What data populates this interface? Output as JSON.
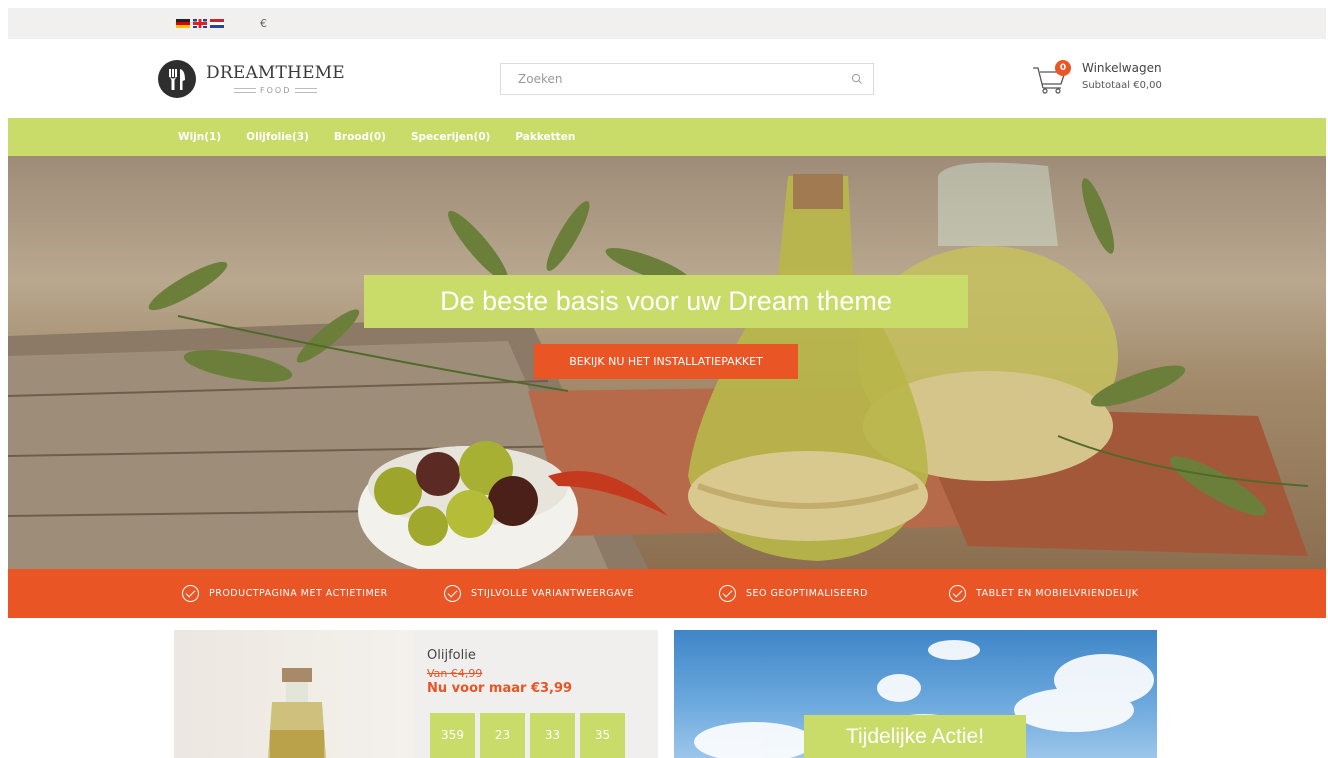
{
  "topbar": {
    "flags": [
      "flag-de",
      "flag-en",
      "flag-nl"
    ],
    "currency": "€"
  },
  "header": {
    "logo_name": "DREAMTHEME",
    "logo_sub": "FOOD",
    "search": {
      "placeholder": "Zoeken",
      "icon": "search-icon"
    },
    "cart": {
      "icon": "cart-icon",
      "count": "0",
      "title": "Winkelwagen",
      "subtotal": "Subtotaal €0,00"
    }
  },
  "nav": {
    "items": [
      {
        "label": "Wijn(1)"
      },
      {
        "label": "Olijfolie(3)"
      },
      {
        "label": "Brood(0)"
      },
      {
        "label": "Specerijen(0)"
      },
      {
        "label": "Pakketten"
      }
    ]
  },
  "hero": {
    "title": "De beste basis voor uw Dream theme",
    "button": "BEKIJK NU HET INSTALLATIEPAKKET"
  },
  "features": [
    {
      "label": "PRODUCTPAGINA MET ACTIETIMER",
      "icon": "check-circle-icon"
    },
    {
      "label": "STIJLVOLLE VARIANTWEERGAVE",
      "icon": "check-circle-icon"
    },
    {
      "label": "SEO GEOPTIMALISEERD",
      "icon": "check-circle-icon"
    },
    {
      "label": "TABLET EN MOBIELVRIENDELIJK",
      "icon": "check-circle-icon"
    }
  ],
  "promo": {
    "product_name": "Olijfolie",
    "old_price": "Van €4,99",
    "new_price": "Nu voor maar €3,99",
    "timer": [
      "359",
      "23",
      "33",
      "35"
    ]
  },
  "promo_right": {
    "title": "Tijdelijke Actie!"
  },
  "colors": {
    "accent_green": "#c9dc69",
    "accent_orange": "#e95524",
    "topbar_bg": "#f1f0ef"
  }
}
